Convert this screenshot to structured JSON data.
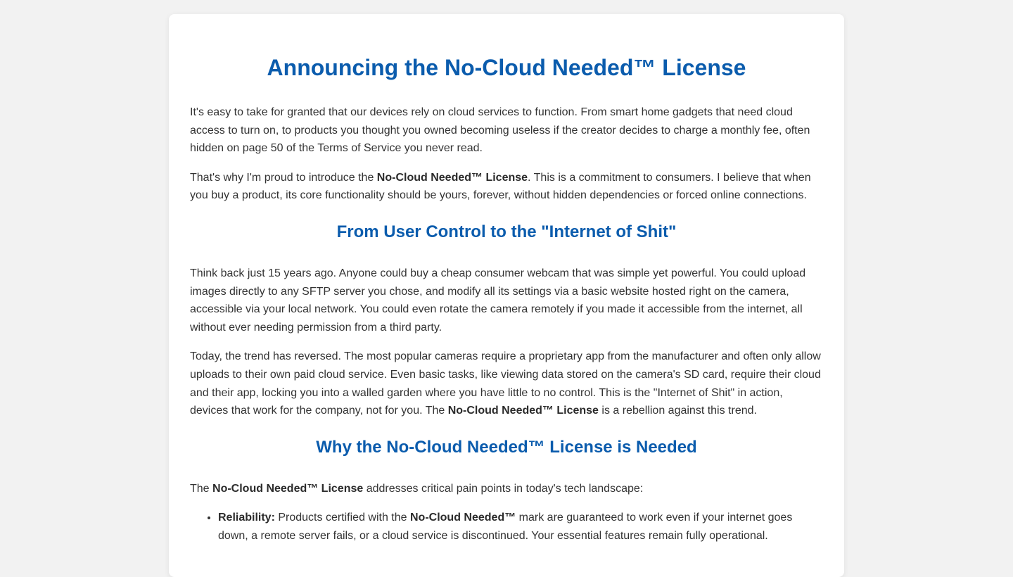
{
  "article": {
    "title": "Announcing the No-Cloud Needed™ License",
    "intro_p1": "It's easy to take for granted that our devices rely on cloud services to function. From smart home gadgets that need cloud access to turn on, to products you thought you owned becoming useless if the creator decides to charge a monthly fee, often hidden on page 50 of the Terms of Service you never read.",
    "intro_p2": {
      "before": "That's why I'm proud to introduce the ",
      "bold": "No-Cloud Needed™ License",
      "after": ". This is a commitment to consumers. I believe that when you buy a product, its core functionality should be yours, forever, without hidden dependencies or forced online connections."
    },
    "section1": {
      "heading": "From User Control to the \"Internet of Shit\"",
      "p1": "Think back just 15 years ago. Anyone could buy a cheap consumer webcam that was simple yet powerful. You could upload images directly to any SFTP server you chose, and modify all its settings via a basic website hosted right on the camera, accessible via your local network. You could even rotate the camera remotely if you made it accessible from the internet, all without ever needing permission from a third party.",
      "p2": {
        "before": "Today, the trend has reversed. The most popular cameras require a proprietary app from the manufacturer and often only allow uploads to their own paid cloud service. Even basic tasks, like viewing data stored on the camera's SD card, require their cloud and their app, locking you into a walled garden where you have little to no control. This is the \"Internet of Shit\" in action, devices that work for the company, not for you. The ",
        "bold": "No-Cloud Needed™ License",
        "after": " is a rebellion against this trend."
      }
    },
    "section2": {
      "heading": "Why the No-Cloud Needed™ License is Needed",
      "intro": {
        "before": "The ",
        "bold": "No-Cloud Needed™ License",
        "after": " addresses critical pain points in today's tech landscape:"
      },
      "items": [
        {
          "label": "Reliability:",
          "text_before": " Products certified with the ",
          "bold": "No-Cloud Needed™",
          "text_after": " mark are guaranteed to work even if your internet goes down, a remote server fails, or a cloud service is discontinued. Your essential features remain fully operational."
        }
      ]
    }
  }
}
